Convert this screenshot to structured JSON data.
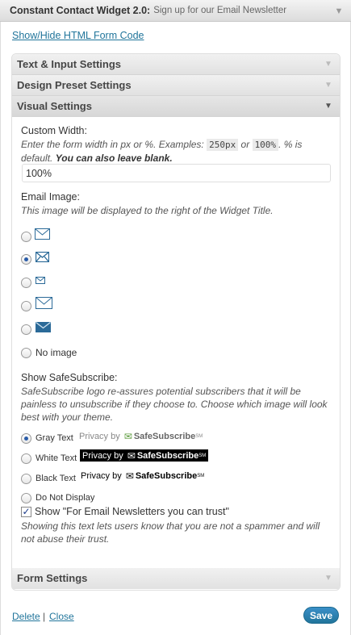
{
  "widget": {
    "title": "Constant Contact Widget 2.0:",
    "subtitle": "Sign up for our Email Newsletter"
  },
  "links": {
    "show_hide": "Show/Hide HTML Form Code",
    "delete": "Delete",
    "separator": "|",
    "close": "Close"
  },
  "sections": {
    "text_input": "Text & Input Settings",
    "design_preset": "Design Preset Settings",
    "visual": "Visual Settings",
    "form": "Form Settings"
  },
  "custom_width": {
    "label": "Custom Width:",
    "desc_1": "Enter the form width in px or %. Examples: ",
    "example_1": "250px",
    "desc_or": " or ",
    "example_2": "100%",
    "desc_2": ". % is default. ",
    "desc_bold": "You can also leave blank.",
    "value": "100%"
  },
  "email_image": {
    "label": "Email Image:",
    "desc": "This image will be displayed to the right of the Widget Title.",
    "options": [
      {
        "icon": "envelope-outline-icon",
        "selected": false
      },
      {
        "icon": "envelope-icon",
        "selected": true
      },
      {
        "icon": "envelope-small-icon",
        "selected": false
      },
      {
        "icon": "envelope-large-outline-icon",
        "selected": false
      },
      {
        "icon": "envelope-filled-icon",
        "selected": false
      }
    ],
    "no_image": "No image"
  },
  "safesubscribe": {
    "label": "Show SafeSubscribe:",
    "desc": "SafeSubscribe logo re-assures potential subscribers that it will be painless to unsubscribe if they choose to. Choose which image will look best with your theme.",
    "privacy_by": "Privacy by",
    "brand": "SafeSubscribe",
    "sm": "SM",
    "options": [
      {
        "label": "Gray Text",
        "selected": true
      },
      {
        "label": "White Text",
        "selected": false
      },
      {
        "label": "Black Text",
        "selected": false
      },
      {
        "label": "Do Not Display",
        "selected": false
      }
    ]
  },
  "trust": {
    "checked": true,
    "label": "Show \"For Email Newsletters you can trust\"",
    "desc": "Showing this text lets users know that you are not a spammer and will not abuse their trust."
  },
  "footer": {
    "save": "Save"
  },
  "colors": {
    "link": "#21759b",
    "save_button": "#21759b",
    "envelope": "#2b6a98"
  }
}
